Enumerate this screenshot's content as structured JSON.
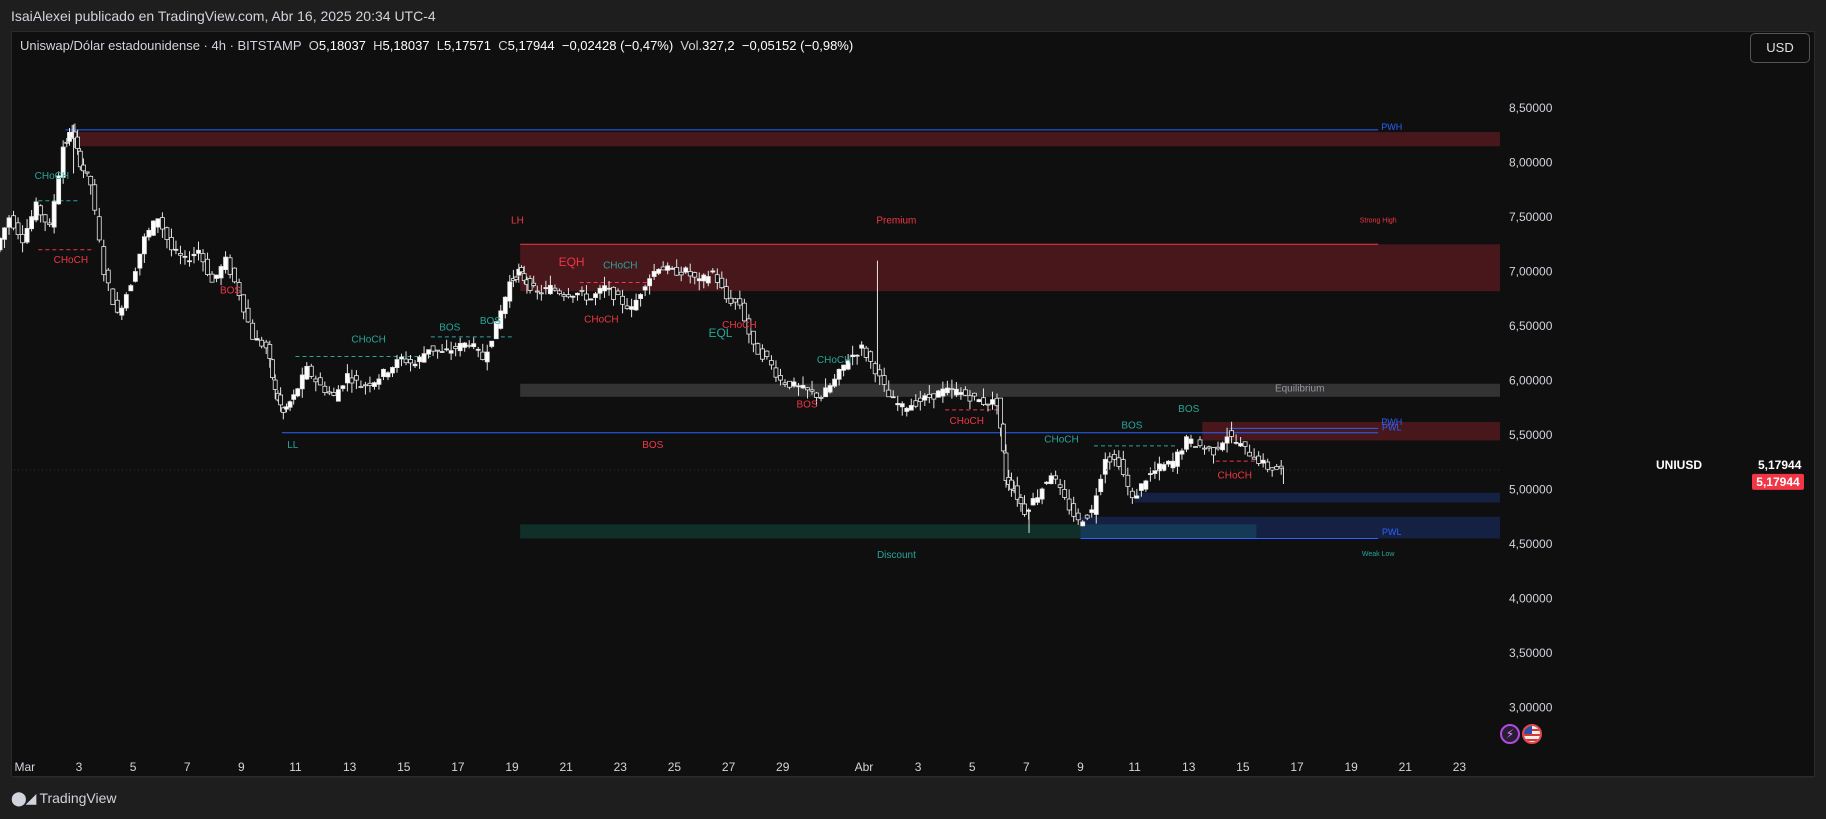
{
  "header": {
    "publisher": "IsaiAlexei publicado en TradingView.com, Abr 16, 2025 20:34 UTC-4"
  },
  "legend": {
    "symbol": "Uniswap/Dólar estadounidense · 4h · BITSTAMP",
    "o_label": "O",
    "o_value": "5,18037",
    "h_label": "H",
    "h_value": "5,18037",
    "l_label": "L",
    "l_value": "5,17571",
    "c_label": "C",
    "c_value": "5,17944",
    "change": "−0,02428 (−0,47%)",
    "vol_label": "Vol.",
    "vol_value": "327,2",
    "vol_change": "−0,05152 (−0,98%)"
  },
  "currency_button": "USD",
  "footer": {
    "logo_text": "TradingView"
  },
  "icons": [
    "lightning-icon",
    "us-flag-icon"
  ],
  "colors": {
    "up_candle": "#ffffff",
    "down_candle": "#ffffff",
    "bullish_label": "#26a69a",
    "bearish_label": "#f23645",
    "premium_zone": "#6b1c23",
    "discount_zone": "#0f3b33",
    "equilibrium_zone": "#3a3a3a",
    "weekly_line": "#2962ff",
    "price_tag": "#f23645"
  },
  "chart_data": {
    "type": "candlestick",
    "symbol_short": "UNIUSD",
    "last_price": "5,17944",
    "ylim": [
      2.7,
      8.85
    ],
    "y_ticks": [
      "3,00000",
      "3,50000",
      "4,00000",
      "4,50000",
      "5,00000",
      "5,50000",
      "6,00000",
      "6,50000",
      "7,00000",
      "7,50000",
      "8,00000",
      "8,50000"
    ],
    "y_tick_values": [
      3.0,
      3.5,
      4.0,
      4.5,
      5.0,
      5.5,
      6.0,
      6.5,
      7.0,
      7.5,
      8.0,
      8.5
    ],
    "x_ticks": [
      {
        "label": "Mar",
        "day": 1
      },
      {
        "label": "3",
        "day": 3
      },
      {
        "label": "5",
        "day": 5
      },
      {
        "label": "7",
        "day": 7
      },
      {
        "label": "9",
        "day": 9
      },
      {
        "label": "11",
        "day": 11
      },
      {
        "label": "13",
        "day": 13
      },
      {
        "label": "15",
        "day": 15
      },
      {
        "label": "17",
        "day": 17
      },
      {
        "label": "19",
        "day": 19
      },
      {
        "label": "21",
        "day": 21
      },
      {
        "label": "23",
        "day": 23
      },
      {
        "label": "25",
        "day": 25
      },
      {
        "label": "27",
        "day": 27
      },
      {
        "label": "29",
        "day": 29
      },
      {
        "label": "Abr",
        "day": 32
      },
      {
        "label": "3",
        "day": 34
      },
      {
        "label": "5",
        "day": 36
      },
      {
        "label": "7",
        "day": 38
      },
      {
        "label": "9",
        "day": 40
      },
      {
        "label": "11",
        "day": 42
      },
      {
        "label": "13",
        "day": 44
      },
      {
        "label": "15",
        "day": 46
      },
      {
        "label": "17",
        "day": 48
      },
      {
        "label": "19",
        "day": 50
      },
      {
        "label": "21",
        "day": 52
      },
      {
        "label": "23",
        "day": 54
      }
    ],
    "price_path": [
      [
        0.0,
        7.2
      ],
      [
        0.5,
        7.5
      ],
      [
        1.0,
        7.3
      ],
      [
        1.5,
        7.6
      ],
      [
        2.0,
        7.4
      ],
      [
        2.5,
        8.15
      ],
      [
        2.8,
        8.3
      ],
      [
        3.1,
        8.0
      ],
      [
        3.5,
        7.8
      ],
      [
        4.0,
        7.0
      ],
      [
        4.5,
        6.6
      ],
      [
        5.0,
        6.9
      ],
      [
        5.5,
        7.3
      ],
      [
        6.0,
        7.5
      ],
      [
        6.5,
        7.2
      ],
      [
        7.0,
        7.1
      ],
      [
        7.5,
        7.2
      ],
      [
        8.0,
        6.9
      ],
      [
        8.5,
        7.1
      ],
      [
        9.0,
        6.8
      ],
      [
        9.5,
        6.4
      ],
      [
        10.0,
        6.3
      ],
      [
        10.3,
        5.9
      ],
      [
        10.6,
        5.7
      ],
      [
        11.0,
        5.85
      ],
      [
        11.5,
        6.1
      ],
      [
        12.0,
        5.95
      ],
      [
        12.5,
        5.85
      ],
      [
        13.0,
        6.05
      ],
      [
        13.5,
        5.95
      ],
      [
        14.0,
        6.0
      ],
      [
        14.5,
        6.1
      ],
      [
        15.0,
        6.2
      ],
      [
        15.5,
        6.15
      ],
      [
        16.0,
        6.3
      ],
      [
        16.5,
        6.25
      ],
      [
        17.0,
        6.3
      ],
      [
        17.5,
        6.35
      ],
      [
        18.0,
        6.2
      ],
      [
        18.5,
        6.5
      ],
      [
        19.0,
        6.9
      ],
      [
        19.3,
        7.0
      ],
      [
        19.6,
        6.9
      ],
      [
        20.0,
        6.8
      ],
      [
        20.5,
        6.85
      ],
      [
        21.0,
        6.8
      ],
      [
        21.5,
        6.8
      ],
      [
        22.0,
        6.75
      ],
      [
        22.5,
        6.85
      ],
      [
        23.0,
        6.75
      ],
      [
        23.5,
        6.65
      ],
      [
        24.0,
        6.9
      ],
      [
        24.5,
        7.05
      ],
      [
        25.0,
        7.0
      ],
      [
        25.5,
        7.0
      ],
      [
        26.0,
        6.9
      ],
      [
        26.5,
        7.0
      ],
      [
        27.0,
        6.75
      ],
      [
        27.5,
        6.7
      ],
      [
        28.0,
        6.3
      ],
      [
        28.5,
        6.2
      ],
      [
        29.0,
        6.0
      ],
      [
        29.5,
        5.95
      ],
      [
        30.0,
        5.9
      ],
      [
        30.5,
        5.85
      ],
      [
        31.0,
        6.0
      ],
      [
        31.5,
        6.2
      ],
      [
        32.0,
        6.3
      ],
      [
        32.5,
        6.1
      ],
      [
        33.0,
        5.85
      ],
      [
        33.5,
        5.75
      ],
      [
        34.0,
        5.8
      ],
      [
        34.5,
        5.85
      ],
      [
        35.0,
        5.9
      ],
      [
        35.5,
        5.9
      ],
      [
        36.0,
        5.85
      ],
      [
        36.5,
        5.8
      ],
      [
        37.0,
        5.8
      ],
      [
        37.3,
        5.1
      ],
      [
        37.6,
        5.0
      ],
      [
        38.0,
        4.8
      ],
      [
        38.5,
        4.95
      ],
      [
        39.0,
        5.15
      ],
      [
        39.5,
        4.9
      ],
      [
        40.0,
        4.7
      ],
      [
        40.5,
        4.8
      ],
      [
        41.0,
        5.3
      ],
      [
        41.5,
        5.25
      ],
      [
        42.0,
        4.9
      ],
      [
        42.5,
        5.1
      ],
      [
        43.0,
        5.2
      ],
      [
        43.5,
        5.25
      ],
      [
        44.0,
        5.45
      ],
      [
        44.5,
        5.4
      ],
      [
        45.0,
        5.35
      ],
      [
        45.5,
        5.5
      ],
      [
        46.0,
        5.4
      ],
      [
        46.5,
        5.3
      ],
      [
        47.0,
        5.2
      ],
      [
        47.5,
        5.18
      ]
    ],
    "spikes": [
      {
        "day": 2.8,
        "high": 8.35,
        "low": 7.9
      },
      {
        "day": 32.5,
        "high": 7.1,
        "low": 6.1
      },
      {
        "day": 38.1,
        "high": 4.8,
        "low": 4.6
      },
      {
        "day": 47.5,
        "high": 5.2,
        "low": 5.05
      }
    ],
    "zones": [
      {
        "name": "pwh-zone",
        "from_day": 3.0,
        "to_day": 55.5,
        "top": 8.28,
        "bottom": 8.15,
        "kind": "premium"
      },
      {
        "name": "premium-zone",
        "from_day": 19.3,
        "to_day": 55.5,
        "top": 7.25,
        "bottom": 6.82,
        "kind": "premium"
      },
      {
        "name": "equilibrium-zone",
        "from_day": 19.3,
        "to_day": 55.5,
        "top": 5.97,
        "bottom": 5.85,
        "kind": "equilibrium"
      },
      {
        "name": "discount-zone",
        "from_day": 19.3,
        "to_day": 46.5,
        "top": 4.68,
        "bottom": 4.55,
        "kind": "discount"
      },
      {
        "name": "resistance-zone",
        "from_day": 44.5,
        "to_day": 55.5,
        "top": 5.62,
        "bottom": 5.45,
        "kind": "premium"
      },
      {
        "name": "demand-zone-upper",
        "from_day": 42.0,
        "to_day": 55.5,
        "top": 4.97,
        "bottom": 4.88,
        "kind": "demand"
      },
      {
        "name": "demand-zone-lower",
        "from_day": 40.0,
        "to_day": 55.5,
        "top": 4.75,
        "bottom": 4.55,
        "kind": "demand"
      }
    ],
    "lines": [
      {
        "name": "pwh-line",
        "from_day": 2.5,
        "to_day": 51.0,
        "price": 8.3,
        "color": "#2962ff"
      },
      {
        "name": "strong-high-line",
        "from_day": 19.3,
        "to_day": 51.0,
        "price": 7.25,
        "color": "#f23645"
      },
      {
        "name": "ll-line",
        "from_day": 10.5,
        "to_day": 51.0,
        "price": 5.52,
        "color": "#2962ff"
      },
      {
        "name": "pwl-line",
        "from_day": 40.0,
        "to_day": 51.0,
        "price": 4.55,
        "color": "#2962ff"
      },
      {
        "name": "pwl2-line",
        "from_day": 45.5,
        "to_day": 51.0,
        "price": 5.56,
        "color": "#2962ff"
      }
    ],
    "dashed_levels": [
      {
        "from_day": 1.5,
        "to_day": 3.0,
        "price": 7.65,
        "color": "#26a69a"
      },
      {
        "from_day": 1.5,
        "to_day": 3.5,
        "price": 7.2,
        "color": "#f23645"
      },
      {
        "from_day": 11.0,
        "to_day": 16.0,
        "price": 6.22,
        "color": "#26a69a"
      },
      {
        "from_day": 16.0,
        "to_day": 19.0,
        "price": 6.4,
        "color": "#26a69a"
      },
      {
        "from_day": 21.5,
        "to_day": 24.0,
        "price": 6.9,
        "color": "#f23645"
      },
      {
        "from_day": 35.0,
        "to_day": 37.0,
        "price": 5.73,
        "color": "#f23645"
      },
      {
        "from_day": 40.5,
        "to_day": 43.5,
        "price": 5.4,
        "color": "#26a69a"
      },
      {
        "from_day": 45.0,
        "to_day": 46.5,
        "price": 5.26,
        "color": "#f23645"
      }
    ],
    "labels": [
      {
        "text": "CHoCH",
        "day": 2.0,
        "price": 7.85,
        "color": "#26a69a",
        "size": 10
      },
      {
        "text": "CHoCH",
        "day": 2.7,
        "price": 7.08,
        "color": "#f23645",
        "size": 10
      },
      {
        "text": "BOS",
        "day": 8.6,
        "price": 6.8,
        "color": "#f23645",
        "size": 10
      },
      {
        "text": "CHoCH",
        "day": 13.7,
        "price": 6.35,
        "color": "#26a69a",
        "size": 10
      },
      {
        "text": "BOS",
        "day": 16.7,
        "price": 6.46,
        "color": "#26a69a",
        "size": 10
      },
      {
        "text": "BOS",
        "day": 18.2,
        "price": 6.52,
        "color": "#26a69a",
        "size": 10
      },
      {
        "text": "LL",
        "day": 10.9,
        "price": 5.38,
        "color": "#26a69a",
        "size": 10
      },
      {
        "text": "BOS",
        "day": 24.2,
        "price": 5.38,
        "color": "#f23645",
        "size": 10
      },
      {
        "text": "LH",
        "day": 19.2,
        "price": 7.44,
        "color": "#f23645",
        "size": 10
      },
      {
        "text": "EQH",
        "day": 21.2,
        "price": 7.05,
        "color": "#f23645",
        "size": 12
      },
      {
        "text": "CHoCH",
        "day": 23.0,
        "price": 7.03,
        "color": "#26a69a",
        "size": 10
      },
      {
        "text": "CHoCH",
        "day": 22.3,
        "price": 6.53,
        "color": "#f23645",
        "size": 10
      },
      {
        "text": "EQL",
        "day": 26.7,
        "price": 6.4,
        "color": "#26a69a",
        "size": 12
      },
      {
        "text": "CHoCH",
        "day": 27.4,
        "price": 6.48,
        "color": "#f23645",
        "size": 10
      },
      {
        "text": "Premium",
        "day": 33.2,
        "price": 7.44,
        "color": "#f23645",
        "size": 10
      },
      {
        "text": "CHoCH",
        "day": 30.9,
        "price": 6.16,
        "color": "#26a69a",
        "size": 10
      },
      {
        "text": "BOS",
        "day": 29.9,
        "price": 5.75,
        "color": "#f23645",
        "size": 10
      },
      {
        "text": "Equilibrium",
        "day": 48.1,
        "price": 5.9,
        "color": "#9598a1",
        "size": 10
      },
      {
        "text": "CHoCH",
        "day": 35.8,
        "price": 5.6,
        "color": "#f23645",
        "size": 10
      },
      {
        "text": "CHoCH",
        "day": 39.3,
        "price": 5.43,
        "color": "#26a69a",
        "size": 10
      },
      {
        "text": "BOS",
        "day": 41.9,
        "price": 5.56,
        "color": "#26a69a",
        "size": 10
      },
      {
        "text": "BOS",
        "day": 44.0,
        "price": 5.71,
        "color": "#26a69a",
        "size": 10
      },
      {
        "text": "CHoCH",
        "day": 45.7,
        "price": 5.1,
        "color": "#f23645",
        "size": 10
      },
      {
        "text": "Discount",
        "day": 33.2,
        "price": 4.37,
        "color": "#26a69a",
        "size": 10
      },
      {
        "text": "Strong High",
        "day": 51.0,
        "price": 7.45,
        "color": "#f23645",
        "size": 7
      },
      {
        "text": "Weak Low",
        "day": 51.0,
        "price": 4.39,
        "color": "#26a69a",
        "size": 7
      },
      {
        "text": "PWH",
        "day": 51.5,
        "price": 8.3,
        "color": "#2962ff",
        "size": 9
      },
      {
        "text": "PWH",
        "day": 51.5,
        "price": 5.59,
        "color": "#2962ff",
        "size": 9
      },
      {
        "text": "PWL",
        "day": 51.5,
        "price": 5.54,
        "color": "#2962ff",
        "size": 9
      },
      {
        "text": "PWL",
        "day": 51.5,
        "price": 4.58,
        "color": "#2962ff",
        "size": 9
      }
    ]
  }
}
